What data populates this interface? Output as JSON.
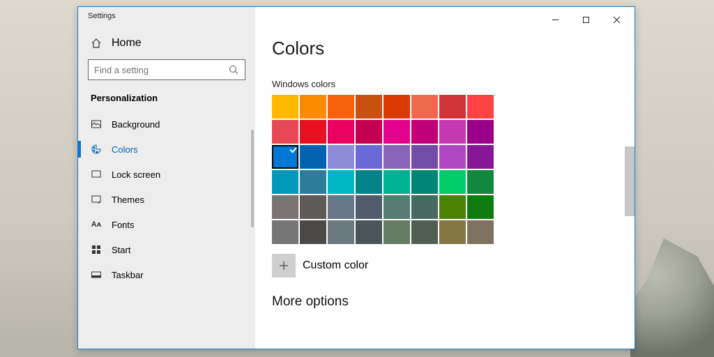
{
  "window_title": "Settings",
  "titlebar": {
    "minimize": "Minimize",
    "maximize": "Maximize",
    "close": "Close"
  },
  "sidebar": {
    "home": "Home",
    "search_placeholder": "Find a setting",
    "section_title": "Personalization",
    "items": [
      {
        "label": "Background",
        "icon": "background"
      },
      {
        "label": "Colors",
        "icon": "colors",
        "active": true
      },
      {
        "label": "Lock screen",
        "icon": "lockscreen"
      },
      {
        "label": "Themes",
        "icon": "themes"
      },
      {
        "label": "Fonts",
        "icon": "fonts"
      },
      {
        "label": "Start",
        "icon": "start"
      },
      {
        "label": "Taskbar",
        "icon": "taskbar"
      }
    ]
  },
  "page": {
    "heading": "Colors",
    "swatch_label": "Windows colors",
    "custom_color": "Custom color",
    "more_options": "More options"
  },
  "colors": {
    "selected_index": 16,
    "palette": [
      "#ffb900",
      "#ff8c00",
      "#f7630c",
      "#ca5010",
      "#da3b01",
      "#ef6950",
      "#d13438",
      "#ff4343",
      "#e74856",
      "#e81123",
      "#ea005e",
      "#c30052",
      "#e3008c",
      "#bf0077",
      "#c239b3",
      "#9a0089",
      "#0078d7",
      "#0063b1",
      "#8e8cd8",
      "#6b69d6",
      "#8764b8",
      "#744da9",
      "#b146c2",
      "#881798",
      "#0099bc",
      "#2d7d9a",
      "#00b7c3",
      "#038387",
      "#00b294",
      "#018574",
      "#00cc6a",
      "#10893e",
      "#7a7574",
      "#5d5a58",
      "#68768a",
      "#515c6b",
      "#567c73",
      "#486860",
      "#498205",
      "#107c10",
      "#767676",
      "#4c4a48",
      "#69797e",
      "#4a5459",
      "#647c64",
      "#525e54",
      "#847545",
      "#7e735f"
    ]
  }
}
